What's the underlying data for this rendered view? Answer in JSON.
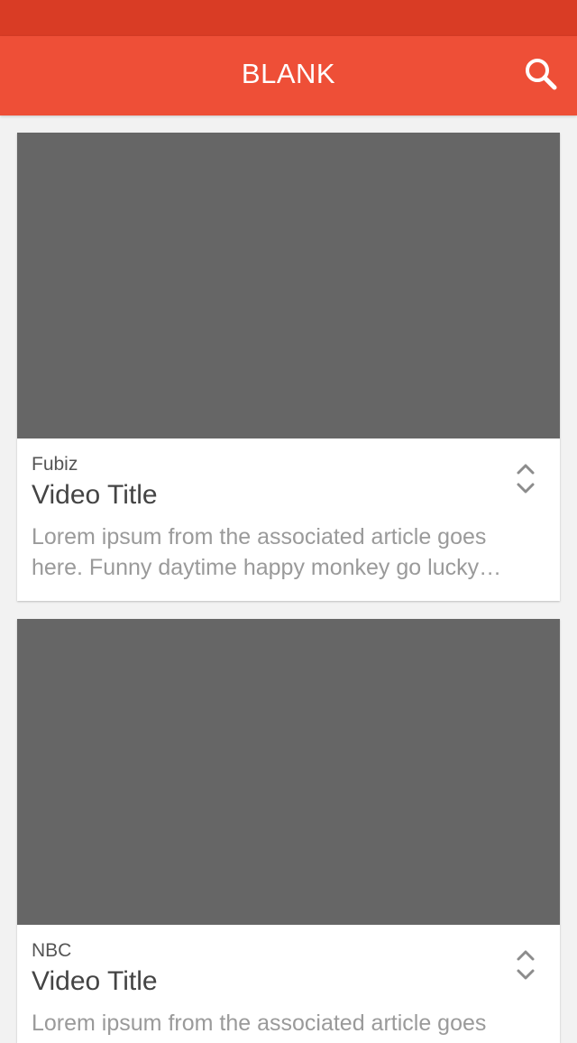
{
  "app_bar": {
    "title": "BLANK",
    "color": "#ee4f37",
    "status_bar_color": "#d93c25",
    "search_icon": "search-icon"
  },
  "feed": {
    "cards": [
      {
        "source": "Fubiz",
        "title": "Video Title",
        "excerpt_line_1": "Lorem ipsum from the associated article goes",
        "excerpt_line_2": "here. Funny daytime happy monkey go lucky…",
        "thumbnail_color": "#666666",
        "icons": [
          "chevron-up-icon",
          "chevron-down-icon"
        ]
      },
      {
        "source": "NBC",
        "title": "Video Title",
        "excerpt_line_1": "Lorem ipsum from the associated article goes",
        "thumbnail_color": "#666666",
        "icons": [
          "chevron-up-icon",
          "chevron-down-icon"
        ]
      }
    ]
  }
}
